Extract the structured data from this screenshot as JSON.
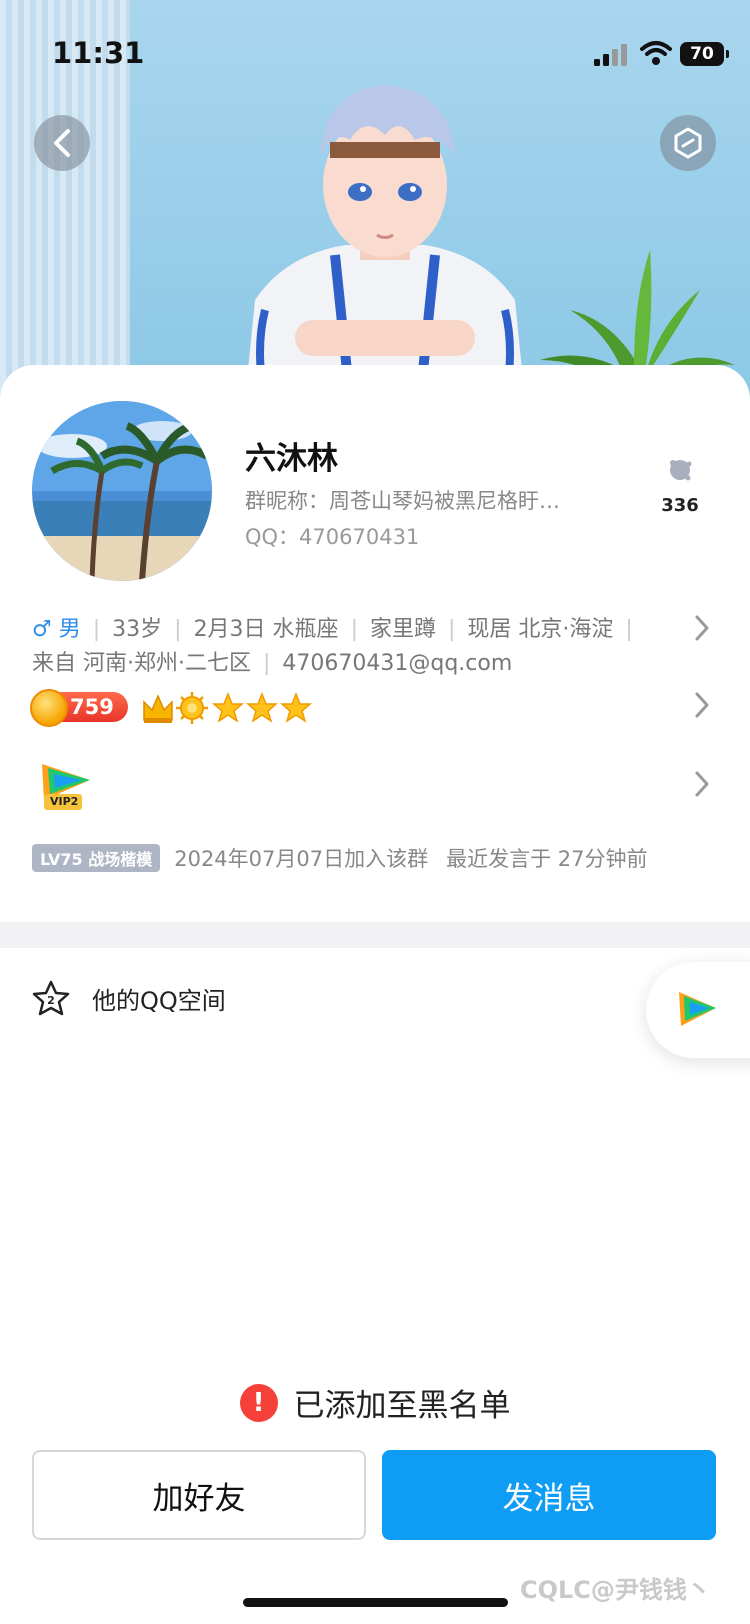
{
  "status_bar": {
    "time": "11:31",
    "battery": "70"
  },
  "profile": {
    "name": "六沐林",
    "group_nickname": "群昵称：周苍山琴妈被黑尼格盱…",
    "qq": "QQ：470670431",
    "like_count": "336"
  },
  "info": {
    "gender": "♂ 男",
    "age": "33岁",
    "birthday": "2月3日 水瓶座",
    "hometown_status": "家里蹲",
    "residence": "现居 北京·海淀",
    "origin": "来自 河南·郑州·二七区",
    "email": "470670431@qq.com"
  },
  "badges": {
    "level_number": "759"
  },
  "vip": {
    "label": "VIP2"
  },
  "group": {
    "level_tag": "LV75 战场楷模",
    "joined": "2024年07月07日加入该群",
    "last_speak": "最近发言于 27分钟前"
  },
  "qzone": {
    "label": "他的QQ空间"
  },
  "notice": {
    "text": "已添加至黑名单"
  },
  "actions": {
    "add_friend": "加好友",
    "send_message": "发消息"
  },
  "watermark": "CQLC@尹钱钱丶",
  "colors": {
    "primary_blue": "#0f9cf5",
    "warning_red": "#f5413a",
    "male_blue": "#2e8ee8"
  }
}
